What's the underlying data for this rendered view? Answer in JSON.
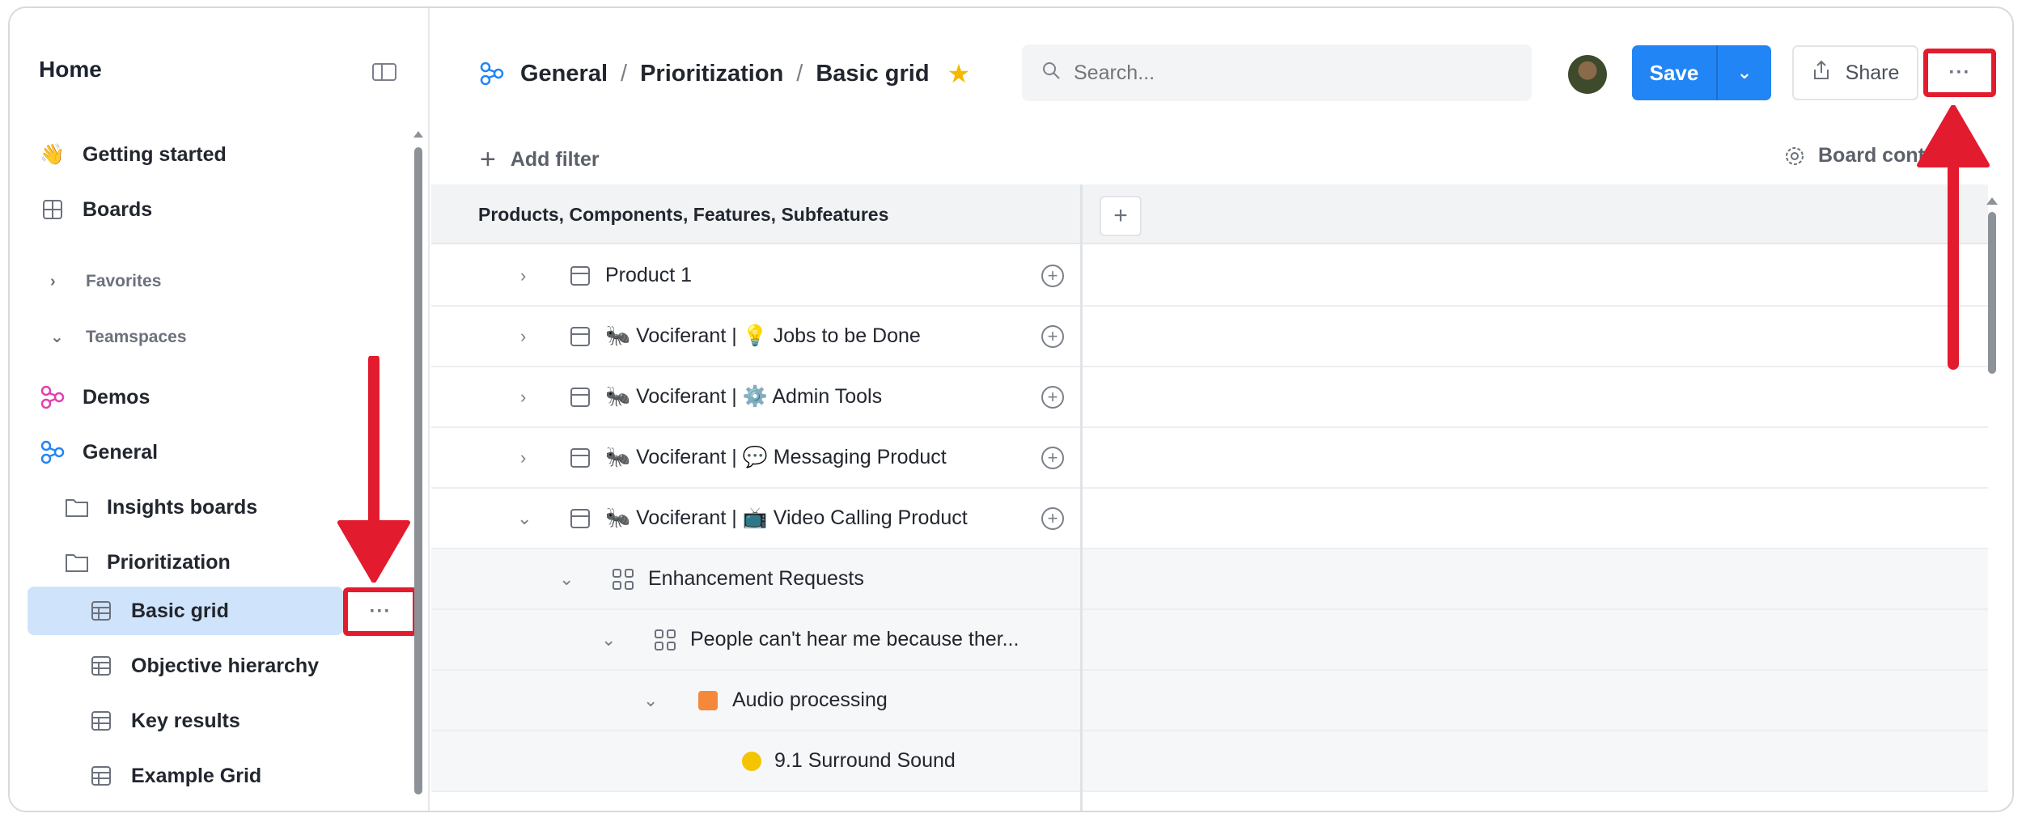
{
  "sidebar": {
    "title": "Home",
    "items": [
      {
        "label": "Getting started",
        "icon": "waving-hand-emoji"
      },
      {
        "label": "Boards",
        "icon": "grid-icon"
      }
    ],
    "sections": {
      "favorites": "Favorites",
      "teamspaces": "Teamspaces"
    },
    "teamspaces": [
      {
        "label": "Demos",
        "icon": "teamspace-icon",
        "color": "#e040b0"
      },
      {
        "label": "General",
        "icon": "teamspace-icon",
        "color": "#2285f5"
      }
    ],
    "folders": [
      {
        "label": "Insights boards"
      },
      {
        "label": "Prioritization"
      }
    ],
    "boards": [
      {
        "label": "Basic grid",
        "selected": true
      },
      {
        "label": "Objective hierarchy"
      },
      {
        "label": "Key results"
      },
      {
        "label": "Example Grid"
      }
    ],
    "more_label": "···"
  },
  "header": {
    "breadcrumb": [
      "General",
      "Prioritization",
      "Basic grid"
    ],
    "breadcrumb_separator": "/",
    "search_placeholder": "Search...",
    "save_label": "Save",
    "share_label": "Share",
    "more_label": "···"
  },
  "toolbar": {
    "add_filter": "Add filter",
    "board_controls": "Board contr"
  },
  "grid": {
    "header": "Products, Components, Features, Subfeatures",
    "rows": [
      {
        "label": "Product 1",
        "prefix": "",
        "emoji": ""
      },
      {
        "label": "Jobs to be Done",
        "prefix": "Vociferant |",
        "emoji": "💡"
      },
      {
        "label": "Admin Tools",
        "prefix": "Vociferant |",
        "emoji": "⚙️"
      },
      {
        "label": "Messaging Product",
        "prefix": "Vociferant |",
        "emoji": "💬"
      },
      {
        "label": "Video Calling Product",
        "prefix": "Vociferant |",
        "emoji": "📺"
      },
      {
        "label": "Enhancement Requests"
      },
      {
        "label": "People can't hear me because ther..."
      },
      {
        "label": "Audio processing"
      },
      {
        "label": "9.1 Surround Sound"
      }
    ]
  },
  "colors": {
    "accent": "#2285f5",
    "annotation": "#e31b2e",
    "selected": "#cfe3fb",
    "star": "#f5b800"
  }
}
